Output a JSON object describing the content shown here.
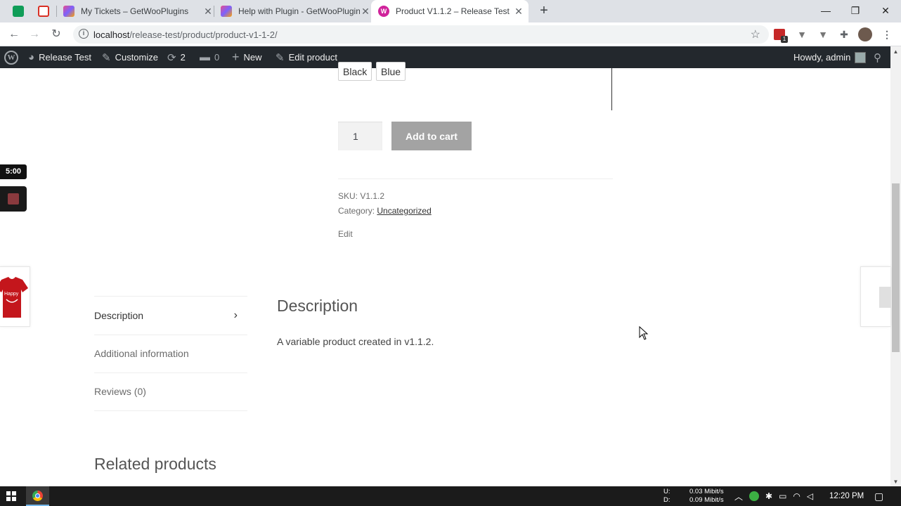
{
  "browser": {
    "tabs": [
      {
        "title": "My Tickets – GetWooPlugins",
        "active": false
      },
      {
        "title": "Help with Plugin - GetWooPlugins",
        "active": false
      },
      {
        "title": "Product V1.1.2 – Release Test",
        "active": true
      }
    ],
    "url_host": "localhost",
    "url_path": "/release-test/product/product-v1-1-2/",
    "extension_badge": "1"
  },
  "adminbar": {
    "site_name": "Release Test",
    "customize": "Customize",
    "updates_count": "2",
    "comments_count": "0",
    "new": "New",
    "edit_product": "Edit product",
    "howdy": "Howdy, admin"
  },
  "product": {
    "swatches": [
      "Black",
      "Blue"
    ],
    "quantity": "1",
    "add_to_cart": "Add to cart",
    "sku_label": "SKU:",
    "sku_value": "V1.1.2",
    "category_label": "Category:",
    "category_value": "Uncategorized",
    "edit_link": "Edit"
  },
  "tabs": {
    "items": [
      "Description",
      "Additional information",
      "Reviews (0)"
    ],
    "active": "Description",
    "panel_heading": "Description",
    "panel_text": "A variable product created in v1.1.2."
  },
  "related_heading": "Related products",
  "recorder": {
    "timer": "5:00"
  },
  "prev_product_image_text": "Happy",
  "taskbar": {
    "net_up_label": "U:",
    "net_down_label": "D:",
    "net_up_value": "0.03 Mibit/s",
    "net_down_value": "0.09 Mibit/s",
    "time": "12:20 PM"
  },
  "colors": {
    "adminbar_bg": "#23282d",
    "add_to_cart_bg": "#a3a3a3",
    "tabstrip_bg": "#dee1e6",
    "taskbar_bg": "#1b1b1b"
  }
}
